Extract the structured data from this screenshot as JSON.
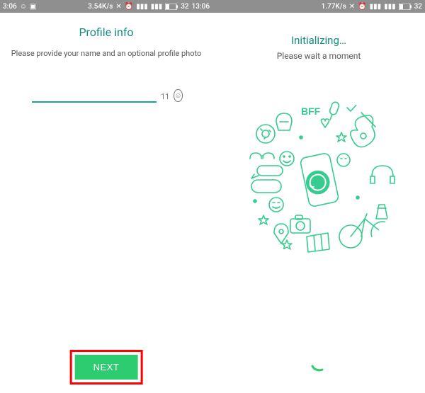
{
  "left": {
    "statusbar": {
      "time": "3:06",
      "data_speed": "3.54K/s",
      "battery": "32",
      "clock": "13:06"
    },
    "title": "Profile info",
    "subtitle": "Please provide your name and an optional profile photo",
    "input_value": "",
    "char_count": "11",
    "next_label": "NEXT"
  },
  "right": {
    "statusbar": {
      "time": "",
      "data_speed": "1.77K/s",
      "battery": "32",
      "clock": ""
    },
    "title": "Initializing…",
    "subtitle": "Please wait a moment"
  },
  "colors": {
    "brand": "#128c7e",
    "accent": "#2ecc71",
    "doodle": "#36cc8f"
  }
}
